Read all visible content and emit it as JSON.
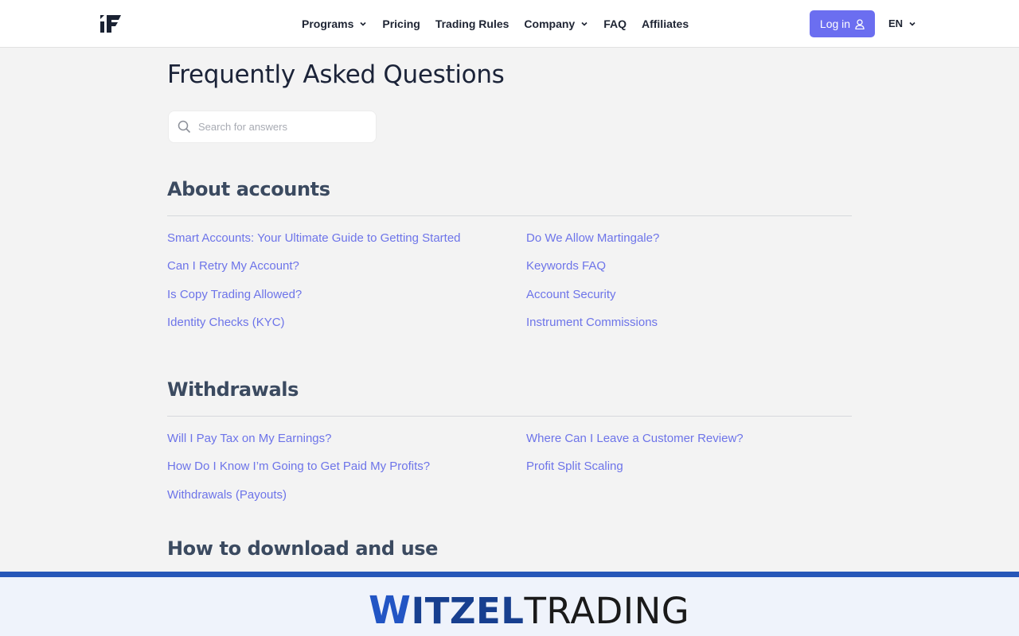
{
  "header": {
    "nav": [
      {
        "label": "Programs",
        "has_dropdown": true
      },
      {
        "label": "Pricing",
        "has_dropdown": false
      },
      {
        "label": "Trading Rules",
        "has_dropdown": false
      },
      {
        "label": "Company",
        "has_dropdown": true
      },
      {
        "label": "FAQ",
        "has_dropdown": false
      },
      {
        "label": "Affiliates",
        "has_dropdown": false
      }
    ],
    "login_label": "Log in",
    "language": "EN"
  },
  "main": {
    "title": "Frequently Asked Questions",
    "search_placeholder": "Search for answers",
    "sections": [
      {
        "title": "About accounts",
        "left_links": [
          "Smart Accounts: Your Ultimate Guide to Getting Started",
          "Can I Retry My Account?",
          "Is Copy Trading Allowed?",
          "Identity Checks (KYC)"
        ],
        "right_links": [
          "Do We Allow Martingale?",
          "Keywords FAQ",
          "Account Security",
          "Instrument Commissions"
        ]
      },
      {
        "title": "Withdrawals",
        "left_links": [
          "Will I Pay Tax on My Earnings?",
          "How Do I Know I’m Going to Get Paid My Profits?",
          "Withdrawals (Payouts)"
        ],
        "right_links": [
          "Where Can I Leave a Customer Review?",
          "Profit Split Scaling"
        ]
      },
      {
        "title": "How to download and use"
      }
    ]
  },
  "banner": {
    "brand_w": "W",
    "brand_itzel": "ITZEL",
    "brand_trading": "TRADING"
  },
  "colors": {
    "accent": "#6b6ef0",
    "link": "#6d74e9",
    "banner_blue": "#2757b8"
  }
}
